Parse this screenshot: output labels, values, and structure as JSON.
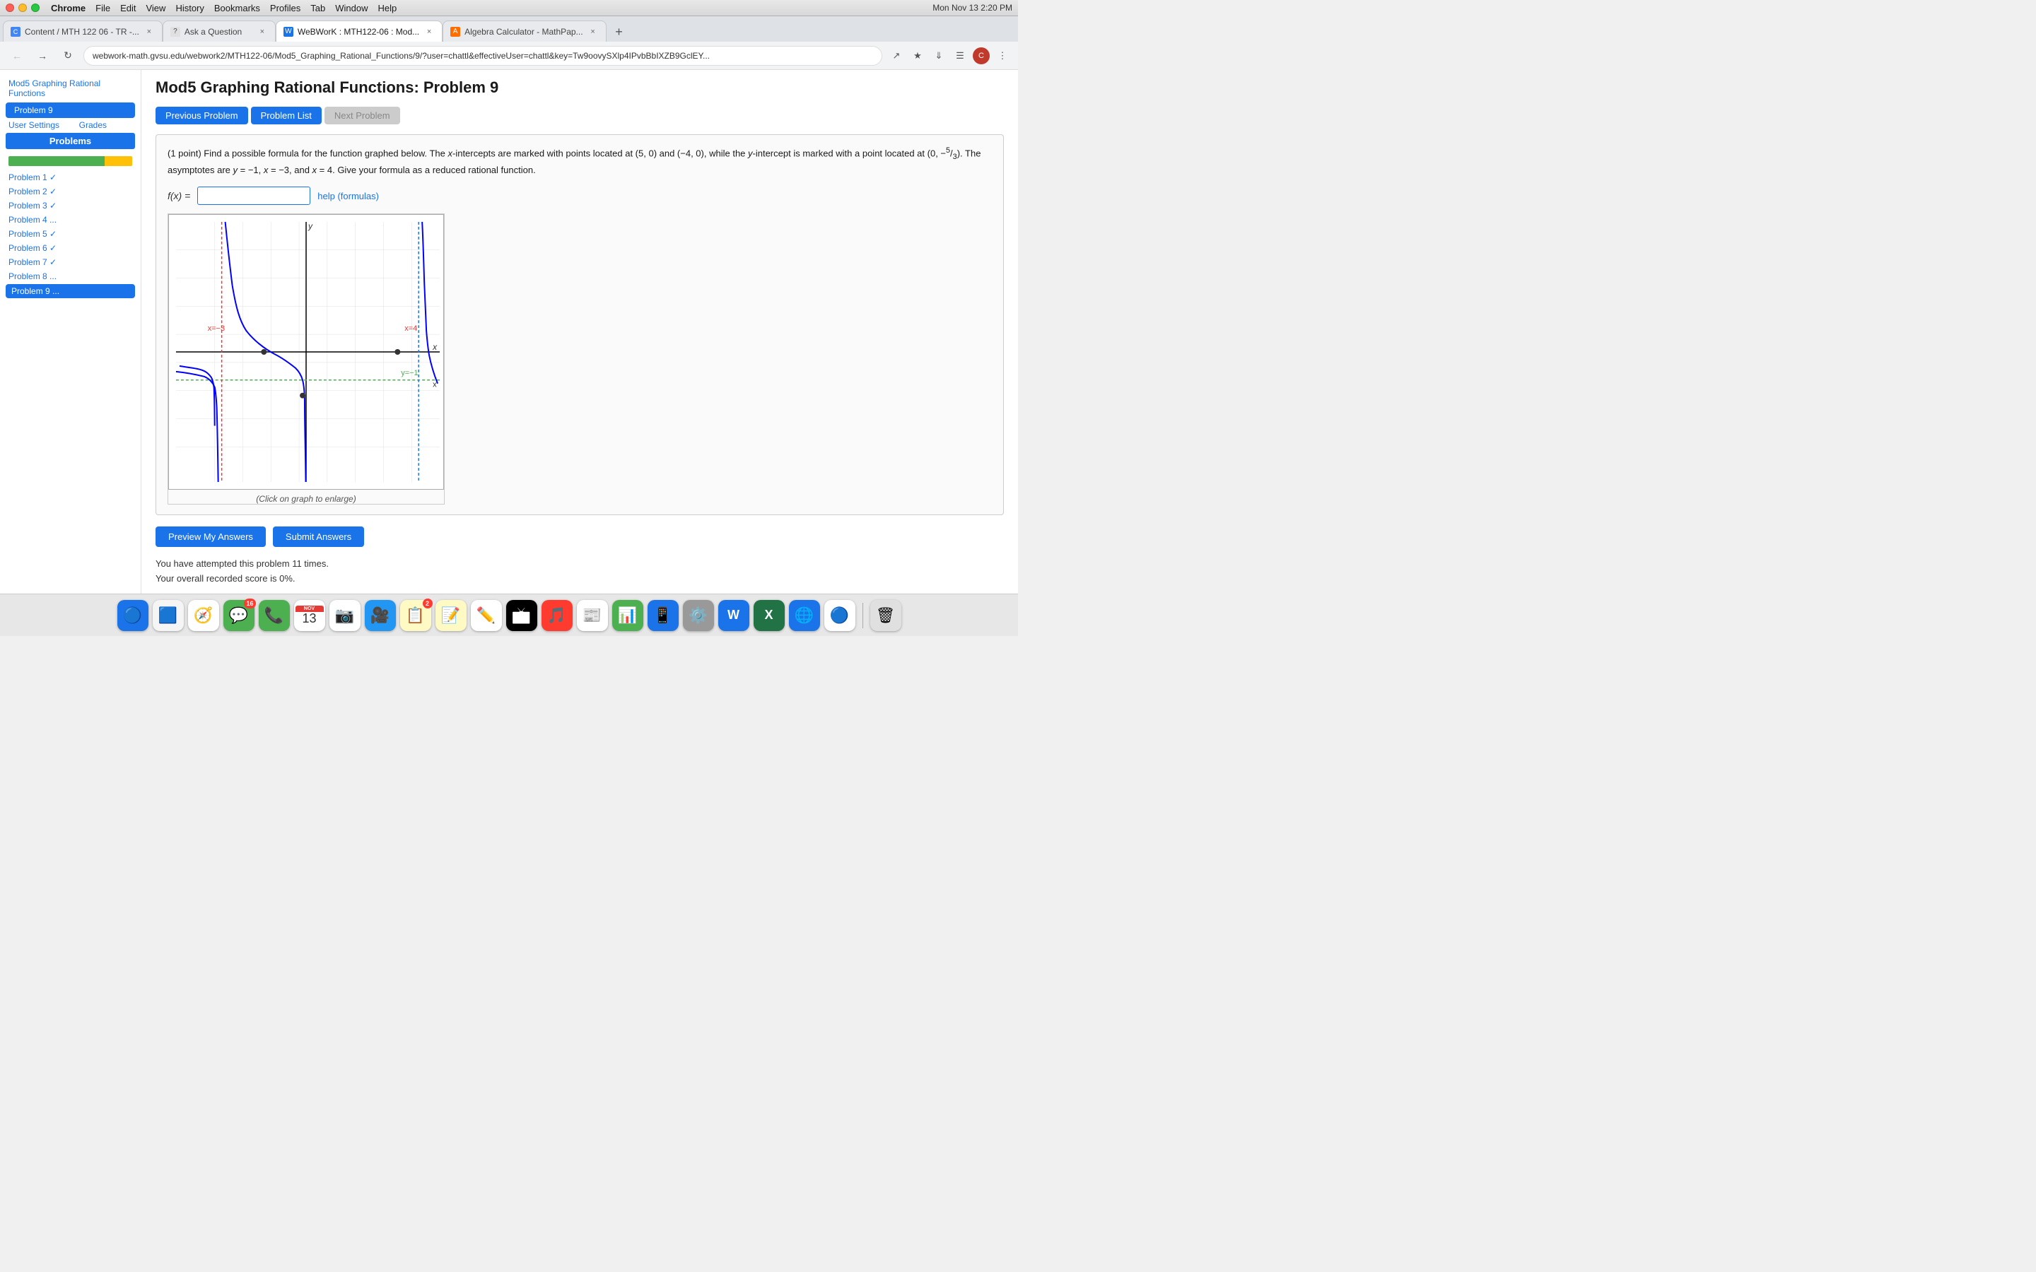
{
  "titlebar": {
    "traffic": [
      "close",
      "minimize",
      "maximize"
    ],
    "menu_items": [
      "Chrome",
      "File",
      "Edit",
      "View",
      "History",
      "Bookmarks",
      "Profiles",
      "Tab",
      "Window",
      "Help"
    ],
    "active_menu": "Chrome",
    "datetime": "Mon Nov 13  2:20 PM"
  },
  "tabs": [
    {
      "id": "tab1",
      "favicon": "📄",
      "title": "Content / MTH 122 06 - TR -...",
      "active": false,
      "closeable": true
    },
    {
      "id": "tab2",
      "favicon": "❓",
      "title": "Ask a Question",
      "active": false,
      "closeable": true
    },
    {
      "id": "tab3",
      "favicon": "📊",
      "title": "WeBWorK : MTH122-06 : Mod...",
      "active": true,
      "closeable": true
    },
    {
      "id": "tab4",
      "favicon": "🔢",
      "title": "Algebra Calculator - MathPap...",
      "active": false,
      "closeable": true
    }
  ],
  "addressbar": {
    "url": "webwork-math.gvsu.edu/webwork2/MTH122-06/Mod5_Graphing_Rational_Functions/9/?user=chattl&effectiveUser=chattl&key=Tw9oovySXlp4IPvbBbIXZB9GclEY..."
  },
  "sidebar": {
    "breadcrumb_label": "Mod5 Graphing Rational Functions",
    "current_problem_label": "Problem 9",
    "user_settings_label": "User Settings",
    "grades_label": "Grades",
    "problems_header": "Problems",
    "problems": [
      {
        "label": "Problem 1 ✓",
        "active": false
      },
      {
        "label": "Problem 2 ✓",
        "active": false
      },
      {
        "label": "Problem 3 ✓",
        "active": false
      },
      {
        "label": "Problem 4 ...",
        "active": false
      },
      {
        "label": "Problem 5 ✓",
        "active": false
      },
      {
        "label": "Problem 6 ✓",
        "active": false
      },
      {
        "label": "Problem 7 ✓",
        "active": false
      },
      {
        "label": "Problem 8 ...",
        "active": false
      },
      {
        "label": "Problem 9 ...",
        "active": true
      }
    ]
  },
  "page": {
    "title": "Mod5 Graphing Rational Functions: Problem 9",
    "nav_buttons": {
      "previous": "Previous Problem",
      "list": "Problem List",
      "next": "Next Problem"
    },
    "problem_text_1": "(1 point) Find a possible formula for the function graphed below. The ",
    "problem_text_x_intercepts": "x",
    "problem_text_2": "-intercepts are marked with points located at (5, 0) and (−4, 0), while the ",
    "problem_text_y": "y",
    "problem_text_3": "-intercept is marked with a point located at (0, −5/3). The asymptotes are y = −1, x = −3, and x = 4. Give your formula as a reduced rational function.",
    "formula_label": "f(x) =",
    "formula_placeholder": "",
    "help_link": "help (formulas)",
    "graph_caption": "(Click on graph to enlarge)",
    "action_buttons": {
      "preview": "Preview My Answers",
      "submit": "Submit Answers"
    },
    "attempt_text_1": "You have attempted this problem 11 times.",
    "attempt_text_2": "Your overall recorded score is 0%."
  },
  "dock": {
    "icons": [
      {
        "emoji": "🔵",
        "label": "finder",
        "badge": null
      },
      {
        "emoji": "🟦",
        "label": "launchpad",
        "badge": null
      },
      {
        "emoji": "🧭",
        "label": "safari",
        "badge": null
      },
      {
        "emoji": "💬",
        "label": "messages",
        "badge": "16"
      },
      {
        "emoji": "📞",
        "label": "facetime",
        "badge": null
      },
      {
        "emoji": "🗓",
        "label": "calendar",
        "date": "13",
        "month": "NOV",
        "badge": null
      },
      {
        "emoji": "📷",
        "label": "photos",
        "badge": null
      },
      {
        "emoji": "🎥",
        "label": "zoom",
        "badge": null
      },
      {
        "emoji": "📝",
        "label": "notes-app",
        "badge": "2"
      },
      {
        "emoji": "📋",
        "label": "stickies",
        "badge": null
      },
      {
        "emoji": "✏️",
        "label": "freeform",
        "badge": null
      },
      {
        "emoji": "🍎",
        "label": "tv",
        "badge": null
      },
      {
        "emoji": "🎵",
        "label": "music",
        "badge": null
      },
      {
        "emoji": "📰",
        "label": "news",
        "badge": null
      },
      {
        "emoji": "📊",
        "label": "numbers",
        "badge": null
      },
      {
        "emoji": "📱",
        "label": "app-store",
        "badge": null
      },
      {
        "emoji": "⚙️",
        "label": "system-preferences",
        "badge": null
      },
      {
        "emoji": "🅦",
        "label": "word",
        "badge": null
      },
      {
        "emoji": "📗",
        "label": "excel",
        "badge": null
      },
      {
        "emoji": "🌐",
        "label": "browser",
        "badge": null
      },
      {
        "emoji": "🔵",
        "label": "chrome",
        "badge": null
      },
      {
        "emoji": "🗑",
        "label": "trash",
        "badge": null
      }
    ]
  }
}
